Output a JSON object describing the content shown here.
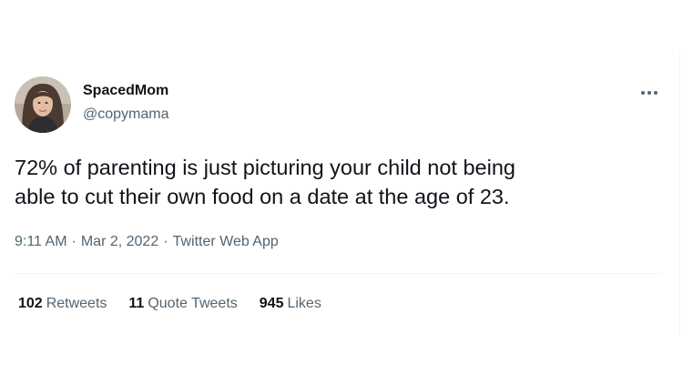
{
  "author": {
    "display_name": "SpacedMom",
    "handle": "@copymama",
    "avatar_icon": "user-avatar-photo"
  },
  "more_icon": "more-horizontal-icon",
  "tweet": {
    "text": "72% of parenting is just picturing your child not being\nable to cut their own food on a date at the age of 23.",
    "time": "9:11 AM",
    "separator": "·",
    "date": "Mar 2, 2022",
    "source": "Twitter Web App"
  },
  "stats": {
    "retweets_count": "102",
    "retweets_label": "Retweets",
    "quotes_count": "11",
    "quotes_label": "Quote Tweets",
    "likes_count": "945",
    "likes_label": "Likes"
  },
  "colors": {
    "text_primary": "#0f1419",
    "text_secondary": "#536471",
    "divider": "#eff3f4"
  }
}
